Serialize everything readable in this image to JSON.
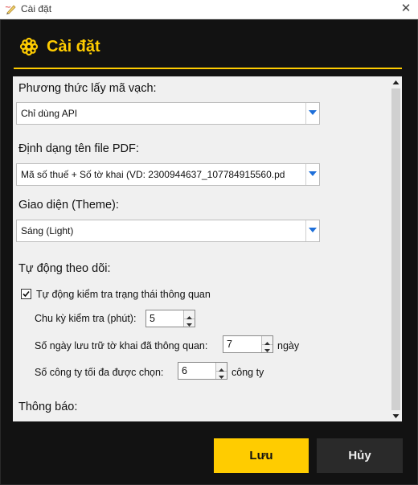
{
  "window": {
    "title": "Cài đặt",
    "close_glyph": "✕",
    "app_icon": "pen-icon"
  },
  "header": {
    "title": "Cài đặt",
    "icon": "gear-icon",
    "accent_color": "#ffcc00"
  },
  "form": {
    "barcode": {
      "label": "Phương thức lấy mã vạch:",
      "value": "Chỉ dùng API"
    },
    "pdf_name": {
      "label": "Định dạng tên file PDF:",
      "value": "Mã số thuế + Số tờ khai (VD: 2300944637_107784915560.pd"
    },
    "theme": {
      "label": "Giao diện (Theme):",
      "value": "Sáng (Light)"
    },
    "auto": {
      "label": "Tự động theo dõi:",
      "check_label": "Tự động kiểm tra trạng thái thông quan",
      "checked": true,
      "interval": {
        "label": "Chu kỳ kiểm tra (phút):",
        "value": "5"
      },
      "keep_days": {
        "label": "Số ngày lưu trữ tờ khai đã thông quan:",
        "value": "7",
        "unit": "ngày"
      },
      "max_companies": {
        "label": "Số công ty tối đa được chọn:",
        "value": "6",
        "unit": "công ty"
      }
    },
    "notify": {
      "label": "Thông báo:"
    }
  },
  "buttons": {
    "save": "Lưu",
    "cancel": "Hủy"
  }
}
